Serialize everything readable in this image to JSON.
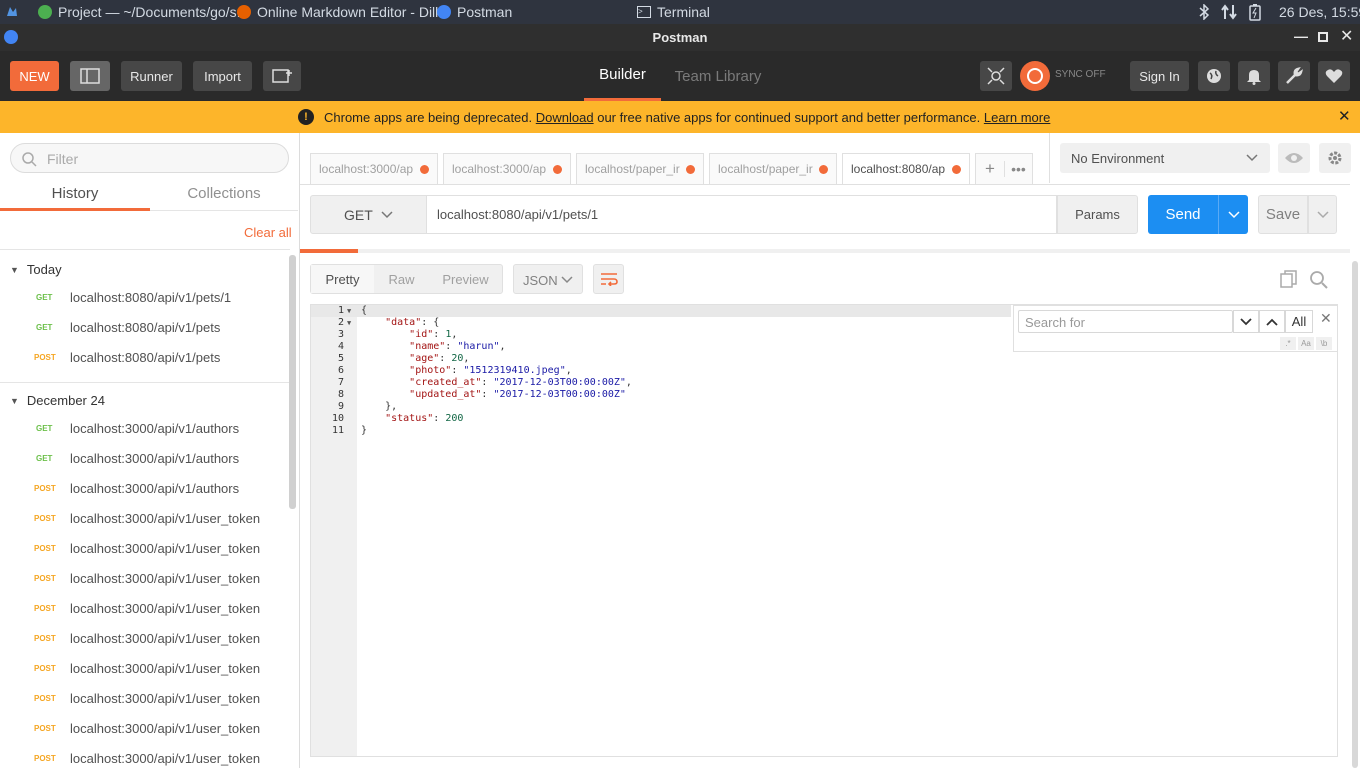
{
  "os_bar": {
    "tasks": [
      "Project — ~/Documents/go/s...",
      "Online Markdown Editor - Dill...",
      "Postman",
      "Terminal"
    ],
    "datetime": "26 Des, 15:59"
  },
  "window": {
    "title": "Postman"
  },
  "header": {
    "new_label": "NEW",
    "runner_label": "Runner",
    "import_label": "Import",
    "tabs": [
      "Builder",
      "Team Library"
    ],
    "sync_label": "SYNC OFF",
    "signin_label": "Sign In"
  },
  "banner": {
    "text_before": "Chrome apps are being deprecated.",
    "download_link": "Download",
    "text_after": "our free native apps for continued support and better performance.",
    "learn_more": "Learn more"
  },
  "sidebar": {
    "filter_placeholder": "Filter",
    "tabs": [
      "History",
      "Collections"
    ],
    "clear_all": "Clear all",
    "groups": [
      {
        "label": "Today",
        "items": [
          {
            "method": "GET",
            "url": "localhost:8080/api/v1/pets/1"
          },
          {
            "method": "GET",
            "url": "localhost:8080/api/v1/pets"
          },
          {
            "method": "POST",
            "url": "localhost:8080/api/v1/pets"
          }
        ]
      },
      {
        "label": "December 24",
        "items": [
          {
            "method": "GET",
            "url": "localhost:3000/api/v1/authors"
          },
          {
            "method": "GET",
            "url": "localhost:3000/api/v1/authors"
          },
          {
            "method": "POST",
            "url": "localhost:3000/api/v1/authors"
          },
          {
            "method": "POST",
            "url": "localhost:3000/api/v1/user_token"
          },
          {
            "method": "POST",
            "url": "localhost:3000/api/v1/user_token"
          },
          {
            "method": "POST",
            "url": "localhost:3000/api/v1/user_token"
          },
          {
            "method": "POST",
            "url": "localhost:3000/api/v1/user_token"
          },
          {
            "method": "POST",
            "url": "localhost:3000/api/v1/user_token"
          },
          {
            "method": "POST",
            "url": "localhost:3000/api/v1/user_token"
          },
          {
            "method": "POST",
            "url": "localhost:3000/api/v1/user_token"
          },
          {
            "method": "POST",
            "url": "localhost:3000/api/v1/user_token"
          },
          {
            "method": "POST",
            "url": "localhost:3000/api/v1/user_token"
          }
        ]
      }
    ]
  },
  "request_tabs": [
    "localhost:3000/ap",
    "localhost:3000/ap",
    "localhost/paper_ir",
    "localhost/paper_ir",
    "localhost:8080/ap"
  ],
  "environment": {
    "selected": "No Environment"
  },
  "request": {
    "method": "GET",
    "url": "localhost:8080/api/v1/pets/1",
    "params_label": "Params",
    "send_label": "Send",
    "save_label": "Save"
  },
  "response": {
    "view_tabs": [
      "Pretty",
      "Raw",
      "Preview"
    ],
    "format": "JSON",
    "search_placeholder": "Search for",
    "search_all": "All",
    "search_opts": [
      ".*",
      "Aa",
      "\\b"
    ],
    "line_numbers": [
      "1",
      "2",
      "3",
      "4",
      "5",
      "6",
      "7",
      "8",
      "9",
      "10",
      "11"
    ],
    "body": {
      "data_key": "\"data\"",
      "id_key": "\"id\"",
      "id_val": "1",
      "name_key": "\"name\"",
      "name_val": "\"harun\"",
      "age_key": "\"age\"",
      "age_val": "20",
      "photo_key": "\"photo\"",
      "photo_val": "\"1512319410.jpeg\"",
      "created_key": "\"created_at\"",
      "created_val": "\"2017-12-03T00:00:00Z\"",
      "updated_key": "\"updated_at\"",
      "updated_val": "\"2017-12-03T00:00:00Z\"",
      "status_key": "\"status\"",
      "status_val": "200"
    }
  },
  "colors": {
    "accent": "#f26b3a",
    "send": "#1c8ef2",
    "get": "#6cc04a",
    "post": "#f5a623",
    "banner": "#fdb52a"
  }
}
